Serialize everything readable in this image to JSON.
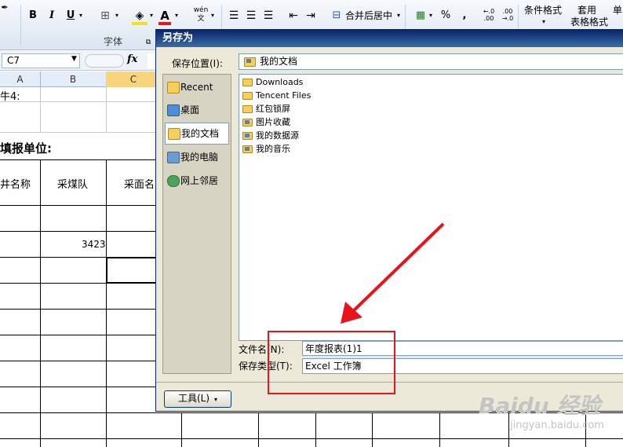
{
  "ribbon": {
    "bold": "B",
    "italic": "I",
    "underline": "U",
    "font_group_label": "字体",
    "wen_label": "wén\n文",
    "merge_center": "合并后居中",
    "percent": "%",
    "comma": ",",
    "dec_inc": "←.0\n.00",
    "dec_dec": ".00\n→.0",
    "conditional_format": "条件格式",
    "table_format_1": "套用",
    "table_format_2": "表格格式",
    "single_cell": "单"
  },
  "formula_bar": {
    "name_box": "C7",
    "fx": "fx"
  },
  "sheet": {
    "columns": [
      "A",
      "B",
      "C"
    ],
    "cells": {
      "row1_text": "牛4:",
      "row3_text": "填报单位:",
      "hdr_a": "井名称",
      "hdr_b": "采煤队",
      "hdr_c": "采面名",
      "value_b": "3423"
    }
  },
  "dialog": {
    "title": "另存为",
    "save_in_label": "保存位置(I):",
    "save_in_value": "我的文档",
    "places": [
      "Recent",
      "桌面",
      "我的文档",
      "我的电脑",
      "网上邻居"
    ],
    "files": [
      "Downloads",
      "Tencent Files",
      "红包锁屏",
      "图片收藏",
      "我的数据源",
      "我的音乐"
    ],
    "filename_label": "文件名(N):",
    "filename_value": "年度报表(1)1",
    "filetype_label": "保存类型(T):",
    "filetype_value": "Excel 工作簿",
    "tools_button": "工具(L)"
  },
  "watermark": {
    "logo": "Baidu 经验",
    "url": "jingyan.baidu.com"
  },
  "colors": {
    "annotation_red": "#e8141c",
    "title_blue": "#0a246a",
    "selected_col": "#f8d57c"
  }
}
